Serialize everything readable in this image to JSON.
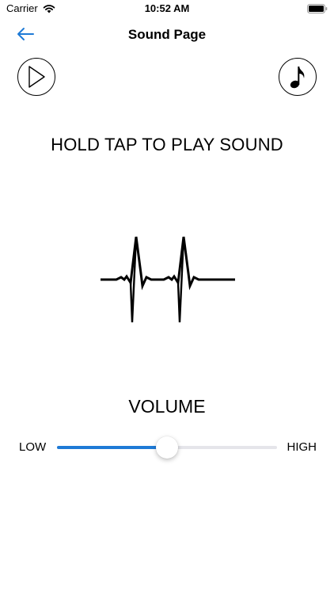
{
  "status_bar": {
    "carrier": "Carrier",
    "time": "10:52 AM"
  },
  "nav": {
    "title": "Sound Page",
    "back_icon": "arrow-left-icon"
  },
  "controls": {
    "play_icon": "play-icon",
    "music_icon": "music-note-icon"
  },
  "instruction": "HOLD TAP TO PLAY SOUND",
  "heartbeat_icon": "heartbeat-icon",
  "volume": {
    "label": "VOLUME",
    "low_label": "LOW",
    "high_label": "HIGH",
    "level": 0.5
  },
  "colors": {
    "accent": "#1e7ad6",
    "track": "#e5e5ea"
  }
}
